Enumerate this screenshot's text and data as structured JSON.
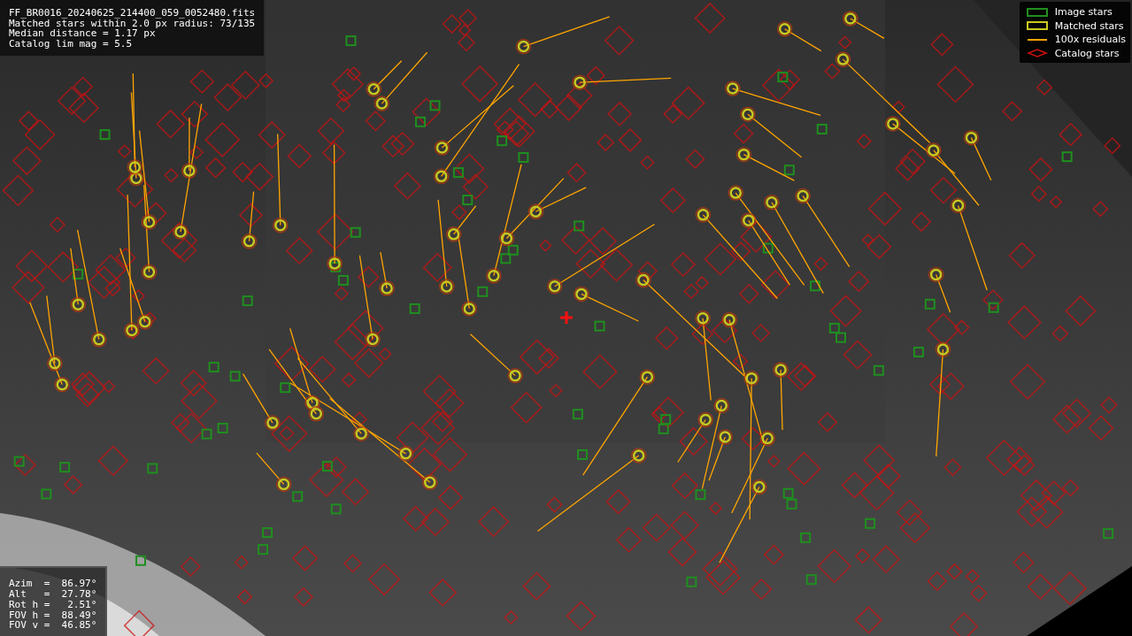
{
  "info": {
    "lines": [
      "FF_BR0016_20240625_214400_059_0052480.fits",
      "Matched stars within 2.0 px radius: 73/135",
      "Median distance = 1.17 px",
      "Catalog lim mag = 5.5"
    ]
  },
  "legend": [
    {
      "kind": "box",
      "label": "Image stars",
      "color": "#1f8f1f"
    },
    {
      "kind": "box",
      "label": "Matched stars",
      "color": "#c8c820"
    },
    {
      "kind": "line",
      "label": "100x residuals",
      "color": "#ffa500"
    },
    {
      "kind": "diamond",
      "label": "Catalog stars",
      "color": "#cc1111"
    }
  ],
  "pointing": {
    "lines": [
      "Azim  =  86.97°",
      "Alt   =  27.78°",
      "Rot h =   2.51°",
      "FOV h =  88.49°",
      "FOV v =  46.85°"
    ]
  }
}
